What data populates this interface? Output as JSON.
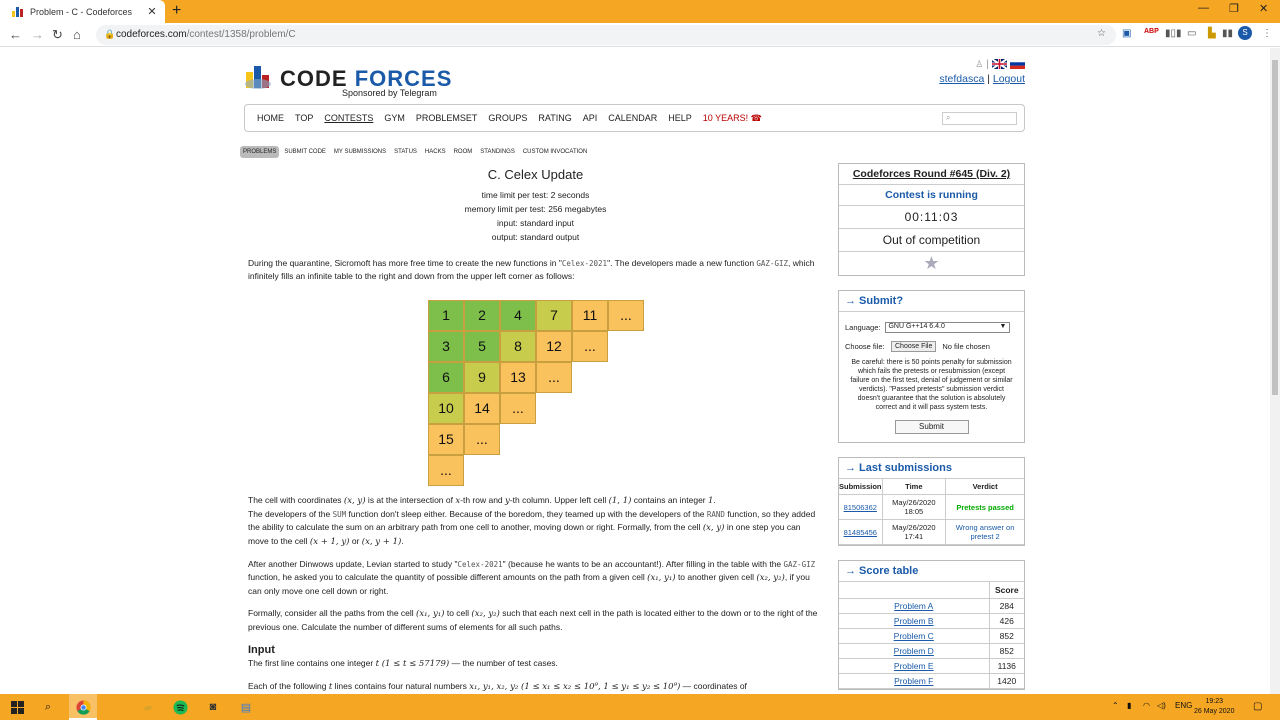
{
  "browser": {
    "tab_title": "Problem - C - Codeforces",
    "new_tab": "+",
    "url_host": "codeforces.com",
    "url_path": "/contest/1358/problem/C",
    "profile_initial": "S"
  },
  "header": {
    "logo_code": "CODE",
    "logo_forces": "FORCES",
    "sponsor": "Sponsored by Telegram",
    "username": "stefdasca",
    "separator": "|",
    "logout": "Logout"
  },
  "menu": {
    "items": [
      "HOME",
      "TOP",
      "CONTESTS",
      "GYM",
      "PROBLEMSET",
      "GROUPS",
      "RATING",
      "API",
      "CALENDAR",
      "HELP"
    ],
    "years": "10 YEARS! ☎"
  },
  "subnav": [
    "PROBLEMS",
    "SUBMIT CODE",
    "MY SUBMISSIONS",
    "STATUS",
    "HACKS",
    "ROOM",
    "STANDINGS",
    "CUSTOM INVOCATION"
  ],
  "problem": {
    "title": "C. Celex Update",
    "time_limit": "time limit per test: 2 seconds",
    "memory_limit": "memory limit per test: 256 megabytes",
    "input": "input: standard input",
    "output": "output: standard output",
    "p1_a": "During the quarantine, Sicromoft has more free time to create the new functions in \"",
    "p1_code1": "Celex-2021",
    "p1_b": "\". The developers made a new function ",
    "p1_code2": "GAZ-GIZ",
    "p1_c": ", which infinitely fills an infinite table to the right and down from the upper left corner as follows:",
    "grid": [
      [
        "1",
        "2",
        "4",
        "7",
        "11",
        "..."
      ],
      [
        "3",
        "5",
        "8",
        "12",
        "..."
      ],
      [
        "6",
        "9",
        "13",
        "..."
      ],
      [
        "10",
        "14",
        "..."
      ],
      [
        "15",
        "..."
      ],
      [
        "..."
      ]
    ],
    "p2_a": "The cell with coordinates ",
    "p2_xy": "(x, y)",
    "p2_b": " is at the intersection of ",
    "p2_x": "x",
    "p2_c": "-th row and ",
    "p2_y": "y",
    "p2_d": "-th column. Upper left cell ",
    "p2_11": "(1, 1)",
    "p2_e": " contains an integer ",
    "p2_1": "1",
    "p2_f": ".",
    "p3_a": "The developers of the ",
    "p3_code1": "SUM",
    "p3_b": " function don't sleep either. Because of the boredom, they teamed up with the developers of the ",
    "p3_code2": "RAND",
    "p3_c": " function, so they added the ability to calculate the sum on an arbitrary path from one cell to another, moving down or right. Formally, from the cell ",
    "p3_xy": "(x, y)",
    "p3_d": " in one step you can move to the cell ",
    "p3_down": "(x + 1, y)",
    "p3_or": " or ",
    "p3_right": "(x, y + 1)",
    "p3_e": ".",
    "p4_a": "After another Dinwows update, Levian started to study \"",
    "p4_code1": "Celex-2021",
    "p4_b": "\" (because he wants to be an accountant!). After filling in the table with the ",
    "p4_code2": "GAZ-GIZ",
    "p4_c": " function, he asked you to calculate the quantity of possible different amounts on the path from a given cell ",
    "p4_c1": "(x₁, y₁)",
    "p4_d": " to another given cell ",
    "p4_c2": "(x₂, y₂)",
    "p4_e": ", if you can only move one cell down or right.",
    "p5_a": "Formally, consider all the paths from the cell ",
    "p5_c1": "(x₁, y₁)",
    "p5_b": " to cell ",
    "p5_c2": "(x₂, y₂)",
    "p5_c": " such that each next cell in the path is located either to the down or to the right of the previous one. Calculate the number of different sums of elements for all such paths.",
    "input_heading": "Input",
    "in1_a": "The first line contains one integer ",
    "in1_t": "t",
    "in1_range": " (1 ≤ t ≤ 57179)",
    "in1_b": " — the number of test cases.",
    "in2_a": "Each of the following ",
    "in2_t": "t",
    "in2_b": " lines contains four natural numbers ",
    "in2_vars": "x₁, y₁, x₂, y₂",
    "in2_range": " (1 ≤ x₁ ≤ x₂ ≤ 10⁹, 1 ≤ y₁ ≤ y₂ ≤ 10⁹)",
    "in2_c": " — coordinates of"
  },
  "sidebar": {
    "round_title": "Codeforces Round #645 (Div. 2)",
    "status": "Contest is running",
    "timer": "00:11:03",
    "competition": "Out of competition",
    "submit_title": "→ Submit?",
    "language_label": "Language:",
    "language_value": "GNU G++14 6.4.0",
    "choose_file_label": "Choose file:",
    "choose_file_button": "Choose File",
    "no_file": "No file chosen",
    "warning": "Be careful: there is 50 points penalty for submission which fails the pretests or resubmission (except failure on the first test, denial of judgement or similar verdicts). \"Passed pretests\" submission verdict doesn't guarantee that the solution is absolutely correct and it will pass system tests.",
    "submit_button": "Submit",
    "last_title": "→ Last submissions",
    "last_headers": [
      "Submission",
      "Time",
      "Verdict"
    ],
    "last_rows": [
      {
        "id": "81506362",
        "time": "May/26/2020 18:05",
        "verdict": "Pretests passed"
      },
      {
        "id": "81485456",
        "time": "May/26/2020 17:41",
        "verdict": "Wrong answer on pretest 2"
      }
    ],
    "score_title": "→ Score table",
    "score_header": "Score",
    "score_rows": [
      {
        "name": "Problem A",
        "score": "284"
      },
      {
        "name": "Problem B",
        "score": "426"
      },
      {
        "name": "Problem C",
        "score": "852"
      },
      {
        "name": "Problem D",
        "score": "852"
      },
      {
        "name": "Problem E",
        "score": "1136"
      },
      {
        "name": "Problem F",
        "score": "1420"
      }
    ]
  },
  "taskbar": {
    "lang": "ENG",
    "time": "19:23",
    "date": "26 May 2020"
  },
  "colors": {
    "chrome": "#f5a623",
    "link": "#1a5aa8",
    "grid_green": "#7dbf4a",
    "grid_yellow_green": "#c8cc4c",
    "grid_orange": "#f9c25c"
  }
}
